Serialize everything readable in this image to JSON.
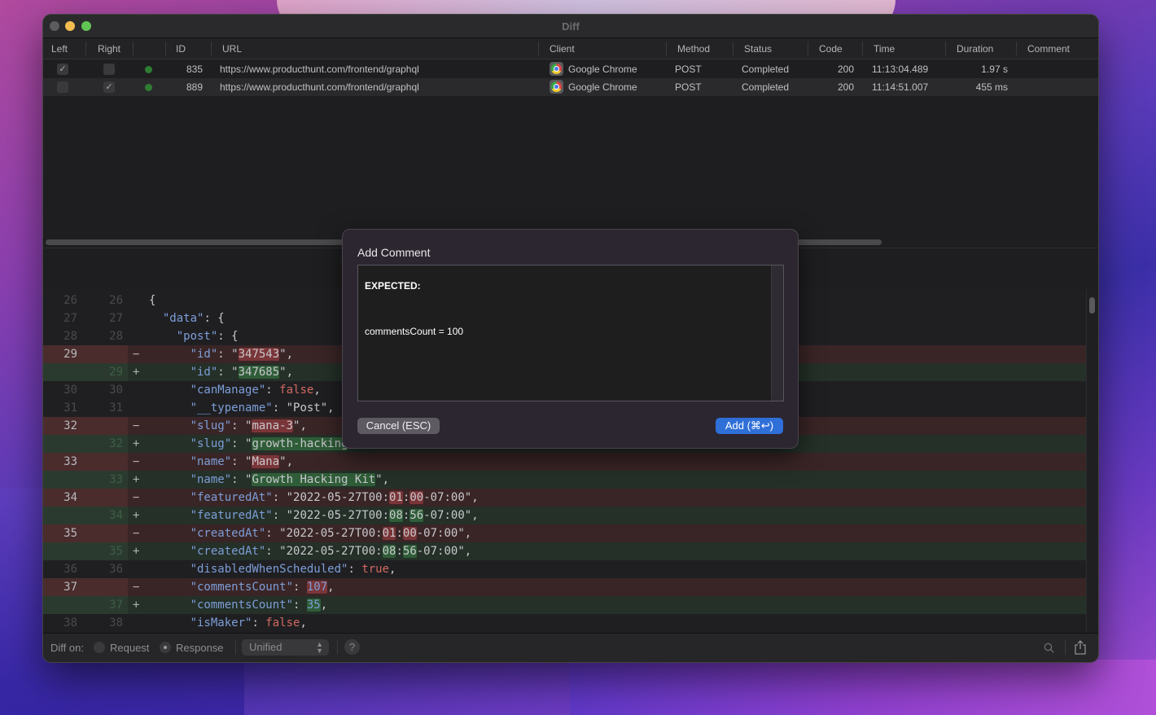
{
  "window": {
    "title": "Diff"
  },
  "table": {
    "columns": [
      "Left",
      "Right",
      "",
      "ID",
      "URL",
      "Client",
      "Method",
      "Status",
      "Code",
      "Time",
      "Duration",
      "Comment"
    ],
    "rows": [
      {
        "left_checked": true,
        "right_checked": false,
        "status_color": "#2e7d32",
        "id": "835",
        "url": "https://www.producthunt.com/frontend/graphql",
        "client": "Google Chrome",
        "method": "POST",
        "status": "Completed",
        "code": "200",
        "time": "11:13:04.489",
        "duration": "1.97 s",
        "comment": ""
      },
      {
        "left_checked": false,
        "right_checked": true,
        "status_color": "#2e7d32",
        "id": "889",
        "url": "https://www.producthunt.com/frontend/graphql",
        "client": "Google Chrome",
        "method": "POST",
        "status": "Completed",
        "code": "200",
        "time": "11:14:51.007",
        "duration": "455 ms",
        "comment": ""
      }
    ]
  },
  "diff": {
    "lines": [
      {
        "type": "ctx",
        "l": "26",
        "r": "26",
        "sign": "",
        "parts": [
          [
            "p",
            "{"
          ]
        ]
      },
      {
        "type": "ctx",
        "l": "27",
        "r": "27",
        "sign": "",
        "parts": [
          [
            "p",
            "  "
          ],
          [
            "k",
            "\"data\""
          ],
          [
            "p",
            ": {"
          ]
        ]
      },
      {
        "type": "ctx",
        "l": "28",
        "r": "28",
        "sign": "",
        "parts": [
          [
            "p",
            "    "
          ],
          [
            "k",
            "\"post\""
          ],
          [
            "p",
            ": {"
          ]
        ]
      },
      {
        "type": "del",
        "l": "29",
        "r": "",
        "sign": "−",
        "parts": [
          [
            "p",
            "      "
          ],
          [
            "k",
            "\"id\""
          ],
          [
            "p",
            ": \""
          ],
          [
            "hd",
            "347543"
          ],
          [
            "p",
            "\","
          ]
        ]
      },
      {
        "type": "add",
        "l": "",
        "r": "29",
        "sign": "+",
        "parts": [
          [
            "p",
            "      "
          ],
          [
            "k",
            "\"id\""
          ],
          [
            "p",
            ": \""
          ],
          [
            "ha",
            "347685"
          ],
          [
            "p",
            "\","
          ]
        ]
      },
      {
        "type": "ctx",
        "l": "30",
        "r": "30",
        "sign": "",
        "parts": [
          [
            "p",
            "      "
          ],
          [
            "k",
            "\"canManage\""
          ],
          [
            "p",
            ": "
          ],
          [
            "b",
            "false"
          ],
          [
            "p",
            ","
          ]
        ]
      },
      {
        "type": "ctx",
        "l": "31",
        "r": "31",
        "sign": "",
        "parts": [
          [
            "p",
            "      "
          ],
          [
            "k",
            "\"__typename\""
          ],
          [
            "p",
            ": \"Post\","
          ]
        ]
      },
      {
        "type": "del",
        "l": "32",
        "r": "",
        "sign": "−",
        "parts": [
          [
            "p",
            "      "
          ],
          [
            "k",
            "\"slug\""
          ],
          [
            "p",
            ": \""
          ],
          [
            "hd",
            "mana-3"
          ],
          [
            "p",
            "\","
          ]
        ]
      },
      {
        "type": "add",
        "l": "",
        "r": "32",
        "sign": "+",
        "parts": [
          [
            "p",
            "      "
          ],
          [
            "k",
            "\"slug\""
          ],
          [
            "p",
            ": \""
          ],
          [
            "ha",
            "growth-hacking"
          ],
          [
            "p",
            "-kit\","
          ]
        ]
      },
      {
        "type": "del",
        "l": "33",
        "r": "",
        "sign": "−",
        "parts": [
          [
            "p",
            "      "
          ],
          [
            "k",
            "\"name\""
          ],
          [
            "p",
            ": \""
          ],
          [
            "hd",
            "Mana"
          ],
          [
            "p",
            "\","
          ]
        ]
      },
      {
        "type": "add",
        "l": "",
        "r": "33",
        "sign": "+",
        "parts": [
          [
            "p",
            "      "
          ],
          [
            "k",
            "\"name\""
          ],
          [
            "p",
            ": \""
          ],
          [
            "ha",
            "Growth Hacking Kit"
          ],
          [
            "p",
            "\","
          ]
        ]
      },
      {
        "type": "del",
        "l": "34",
        "r": "",
        "sign": "−",
        "parts": [
          [
            "p",
            "      "
          ],
          [
            "k",
            "\"featuredAt\""
          ],
          [
            "p",
            ": \"2022-05-27T00:"
          ],
          [
            "hd",
            "01"
          ],
          [
            "p",
            ":"
          ],
          [
            "hd",
            "00"
          ],
          [
            "p",
            "-07:00\","
          ]
        ]
      },
      {
        "type": "add",
        "l": "",
        "r": "34",
        "sign": "+",
        "parts": [
          [
            "p",
            "      "
          ],
          [
            "k",
            "\"featuredAt\""
          ],
          [
            "p",
            ": \"2022-05-27T00:"
          ],
          [
            "ha",
            "08"
          ],
          [
            "p",
            ":"
          ],
          [
            "ha",
            "56"
          ],
          [
            "p",
            "-07:00\","
          ]
        ]
      },
      {
        "type": "del",
        "l": "35",
        "r": "",
        "sign": "−",
        "parts": [
          [
            "p",
            "      "
          ],
          [
            "k",
            "\"createdAt\""
          ],
          [
            "p",
            ": \"2022-05-27T00:"
          ],
          [
            "hd",
            "01"
          ],
          [
            "p",
            ":"
          ],
          [
            "hd",
            "00"
          ],
          [
            "p",
            "-07:00\","
          ]
        ]
      },
      {
        "type": "add",
        "l": "",
        "r": "35",
        "sign": "+",
        "parts": [
          [
            "p",
            "      "
          ],
          [
            "k",
            "\"createdAt\""
          ],
          [
            "p",
            ": \"2022-05-27T00:"
          ],
          [
            "ha",
            "08"
          ],
          [
            "p",
            ":"
          ],
          [
            "ha",
            "56"
          ],
          [
            "p",
            "-07:00\","
          ]
        ]
      },
      {
        "type": "ctx",
        "l": "36",
        "r": "36",
        "sign": "",
        "parts": [
          [
            "p",
            "      "
          ],
          [
            "k",
            "\"disabledWhenScheduled\""
          ],
          [
            "p",
            ": "
          ],
          [
            "b",
            "true"
          ],
          [
            "p",
            ","
          ]
        ]
      },
      {
        "type": "del",
        "l": "37",
        "r": "",
        "sign": "−",
        "parts": [
          [
            "p",
            "      "
          ],
          [
            "k",
            "\"commentsCount\""
          ],
          [
            "p",
            ": "
          ],
          [
            "hdn",
            "107"
          ],
          [
            "p",
            ","
          ]
        ]
      },
      {
        "type": "add",
        "l": "",
        "r": "37",
        "sign": "+",
        "parts": [
          [
            "p",
            "      "
          ],
          [
            "k",
            "\"commentsCount\""
          ],
          [
            "p",
            ": "
          ],
          [
            "han",
            "35"
          ],
          [
            "p",
            ","
          ]
        ]
      },
      {
        "type": "ctx",
        "l": "38",
        "r": "38",
        "sign": "",
        "parts": [
          [
            "p",
            "      "
          ],
          [
            "k",
            "\"isMaker\""
          ],
          [
            "p",
            ": "
          ],
          [
            "b",
            "false"
          ],
          [
            "p",
            ","
          ]
        ]
      }
    ]
  },
  "footer": {
    "diff_on_label": "Diff on:",
    "request_label": "Request",
    "response_label": "Response",
    "selected": "Response",
    "mode_select": "Unified",
    "help_label": "?"
  },
  "dialog": {
    "title": "Add Comment",
    "comment_heading": "EXPECTED:",
    "comment_body": "commentsCount = 100",
    "cancel_label": "Cancel (ESC)",
    "add_label": "Add (⌘↩)",
    "accent_color": "#2f6fd8"
  }
}
